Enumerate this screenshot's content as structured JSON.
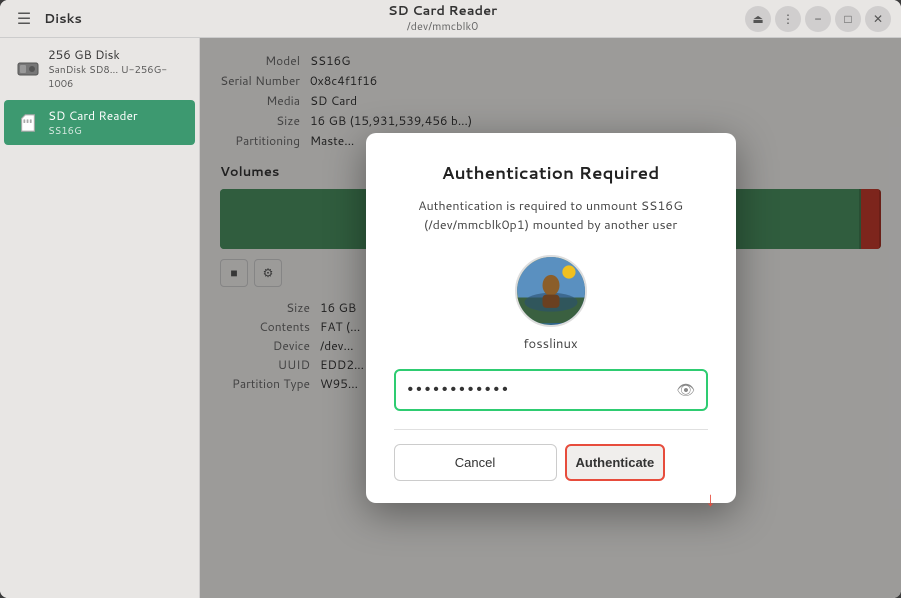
{
  "titlebar": {
    "app_name": "Disks",
    "device_name": "SD Card Reader",
    "device_path": "/dev/mmcblk0",
    "menu_icon": "☰",
    "eject_icon": "⏏",
    "kebab_icon": "⋮",
    "minimize_icon": "−",
    "maximize_icon": "□",
    "close_icon": "✕"
  },
  "sidebar": {
    "items": [
      {
        "id": "disk-256",
        "name": "256 GB Disk",
        "sub": "SanDisk SD8... U-256G-1006",
        "active": false
      },
      {
        "id": "sd-card-reader",
        "name": "SD Card Reader",
        "sub": "SS16G",
        "active": true
      }
    ]
  },
  "device_info": {
    "model_label": "Model",
    "model_value": "SS16G",
    "serial_label": "Serial Number",
    "serial_value": "0x8c4f1f16",
    "media_label": "Media",
    "media_value": "SD Card",
    "size_label": "Size",
    "size_value": "16 GB (15,931,539,456 b...)",
    "partitioning_label": "Partitioning",
    "partitioning_value": "Maste..."
  },
  "volumes": {
    "title": "Volumes",
    "partition_info": {
      "size_label": "Size",
      "size_value": "16 GB",
      "contents_label": "Contents",
      "contents_value": "FAT (...",
      "device_label": "Device",
      "device_value": "/dev...",
      "uuid_label": "UUID",
      "uuid_value": "EDD2...",
      "partition_type_label": "Partition Type",
      "partition_type_value": "W95..."
    }
  },
  "dialog": {
    "title": "Authentication Required",
    "message": "Authentication is required to unmount SS16G (/dev/mmcblk0p1) mounted by another user",
    "username": "fosslinux",
    "password_placeholder": "••••••••••••",
    "password_value": "••••••••••••",
    "eye_icon": "👁",
    "cancel_label": "Cancel",
    "authenticate_label": "Authenticate"
  }
}
